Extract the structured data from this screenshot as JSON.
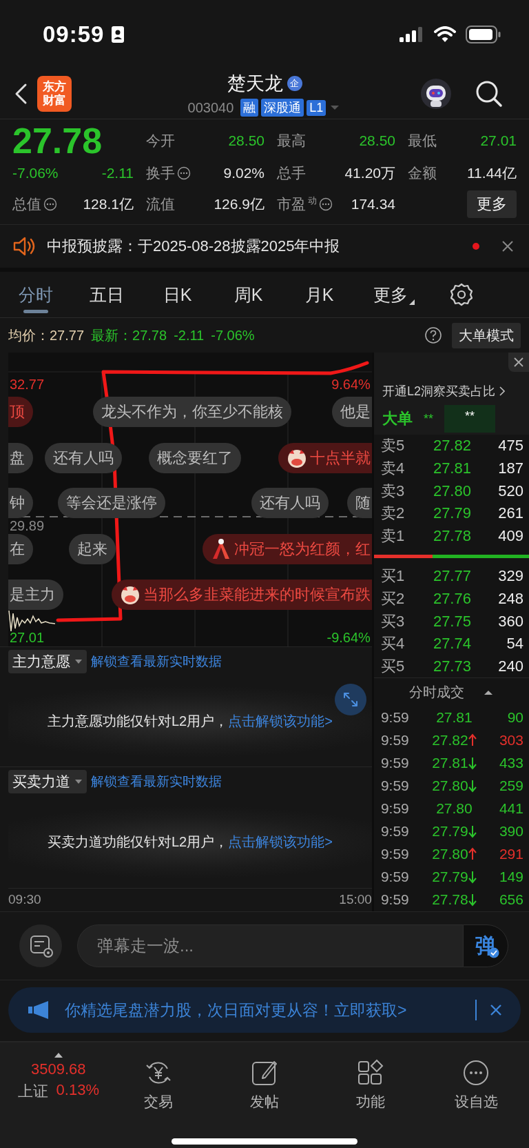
{
  "status_bar": {
    "time": "09:59"
  },
  "header": {
    "logo": "东方财富",
    "title": "楚天龙",
    "title_badge": "企",
    "code": "003040",
    "tags": [
      "融",
      "深股通",
      "L1"
    ]
  },
  "quote": {
    "price": "27.78",
    "color": "#2bc42b",
    "change_pct": "-7.06%",
    "change": "-2.11",
    "stats": [
      {
        "label": "今开",
        "value": "28.50",
        "color": "#2bc42b",
        "info": false
      },
      {
        "label": "最高",
        "value": "28.50",
        "color": "#2bc42b",
        "info": false
      },
      {
        "label": "最低",
        "value": "27.01",
        "color": "#2bc42b",
        "info": false
      },
      {
        "label": "换手",
        "value": "9.02%",
        "color": "#e6e6e6",
        "info": true
      },
      {
        "label": "总手",
        "value": "41.20万",
        "color": "#e6e6e6",
        "info": false
      },
      {
        "label": "金额",
        "value": "11.44亿",
        "color": "#e6e6e6",
        "info": false
      },
      {
        "label": "总值",
        "value": "128.1亿",
        "color": "#e6e6e6",
        "info": true
      },
      {
        "label": "流值",
        "value": "126.9亿",
        "color": "#e6e6e6",
        "info": false
      },
      {
        "label": "市盈",
        "sup": "动",
        "value": "174.34",
        "color": "#e6e6e6",
        "info": true
      }
    ],
    "more_button": "更多"
  },
  "notice": {
    "text": "中报预披露：于2025-08-28披露2025年中报"
  },
  "tabs": [
    {
      "label": "分时",
      "selected": true,
      "kind": "tab"
    },
    {
      "label": "五日",
      "selected": false,
      "kind": "tab"
    },
    {
      "label": "日K",
      "selected": false,
      "kind": "tab"
    },
    {
      "label": "周K",
      "selected": false,
      "kind": "tab"
    },
    {
      "label": "月K",
      "selected": false,
      "kind": "tab"
    },
    {
      "label": "更多",
      "selected": false,
      "kind": "menu"
    }
  ],
  "info_line": {
    "avg_label": "均价：",
    "avg_value": "27.77",
    "latest_label": "最新：",
    "latest_value": "27.78",
    "latest_change": "-2.11",
    "latest_pct": "-7.06%",
    "mode_button": "大单模式"
  },
  "chart": {
    "price_high": "32.77",
    "pct_high": "9.64%",
    "price_prev": "29.89",
    "price_low": "27.01",
    "pct_low": "-9.64%",
    "danmaku": [
      [
        {
          "text": "顶",
          "kind": "red"
        },
        {
          "text": "龙头不作为，你至少不能核",
          "kind": "plain"
        },
        {
          "text": "他是",
          "kind": "plain"
        }
      ],
      [
        {
          "text": "盘",
          "kind": "plain"
        },
        {
          "text": "还有人吗",
          "kind": "plain"
        },
        {
          "text": "概念要红了",
          "kind": "plain"
        },
        {
          "text": "十点半就",
          "kind": "red_mascot"
        }
      ],
      [
        {
          "text": "钟",
          "kind": "plain"
        },
        {
          "text": "等会还是涨停",
          "kind": "plain"
        },
        {
          "text": "还有人吗",
          "kind": "plain"
        },
        {
          "text": "随",
          "kind": "plain"
        }
      ],
      [
        {
          "text": "在",
          "kind": "plain"
        },
        {
          "text": "起来",
          "kind": "plain"
        },
        {
          "text": "冲冠一怒为红颜，红",
          "kind": "red_cracker"
        }
      ],
      [
        {
          "text": "是主力",
          "kind": "plain"
        },
        {
          "text": "当那么多韭菜能进来的时候宣布跌",
          "kind": "red_mascot"
        }
      ]
    ]
  },
  "panels": [
    {
      "title": "主力意愿",
      "link": "解锁查看最新实时数据",
      "message": "主力意愿功能仅针对L2用户，",
      "action": "点击解锁该功能>",
      "expand_button": true
    },
    {
      "title": "买卖力道",
      "link": "解锁查看最新实时数据",
      "message": "买卖力道功能仅针对L2用户，",
      "action": "点击解锁该功能>",
      "expand_button": false
    }
  ],
  "time_axis": {
    "start": "09:30",
    "end": "15:00"
  },
  "order_book": {
    "promo": "开通L2洞察买卖占比",
    "big_order_label": "大单",
    "big_order_values": [
      "**",
      "**"
    ],
    "asks": [
      {
        "label": "卖5",
        "price": "27.82",
        "volume": "475"
      },
      {
        "label": "卖4",
        "price": "27.81",
        "volume": "187"
      },
      {
        "label": "卖3",
        "price": "27.80",
        "volume": "520"
      },
      {
        "label": "卖2",
        "price": "27.79",
        "volume": "261"
      },
      {
        "label": "卖1",
        "price": "27.78",
        "volume": "409"
      }
    ],
    "split": {
      "level": 0.38
    },
    "bids": [
      {
        "label": "买1",
        "price": "27.77",
        "volume": "329"
      },
      {
        "label": "买2",
        "price": "27.76",
        "volume": "248"
      },
      {
        "label": "买3",
        "price": "27.75",
        "volume": "360"
      },
      {
        "label": "买4",
        "price": "27.74",
        "volume": "54"
      },
      {
        "label": "买5",
        "price": "27.73",
        "volume": "240"
      }
    ],
    "trades_title": "分时成交",
    "trades": [
      {
        "time": "9:59",
        "price": "27.81",
        "volume": "90",
        "kind": "plain"
      },
      {
        "time": "9:59",
        "price": "27.82",
        "volume": "303",
        "kind": "up"
      },
      {
        "time": "9:59",
        "price": "27.81",
        "volume": "433",
        "kind": "down"
      },
      {
        "time": "9:59",
        "price": "27.80",
        "volume": "259",
        "kind": "down"
      },
      {
        "time": "9:59",
        "price": "27.80",
        "volume": "441",
        "kind": "plain"
      },
      {
        "time": "9:59",
        "price": "27.79",
        "volume": "390",
        "kind": "down"
      },
      {
        "time": "9:59",
        "price": "27.80",
        "volume": "291",
        "kind": "up"
      },
      {
        "time": "9:59",
        "price": "27.79",
        "volume": "149",
        "kind": "down"
      },
      {
        "time": "9:59",
        "price": "27.78",
        "volume": "656",
        "kind": "down"
      }
    ]
  },
  "comment_bar": {
    "placeholder": "弹幕走一波...",
    "send_button": "弹"
  },
  "promo_banner": {
    "text": "你精选尾盘潜力股，次日面对更从容！立即获取>"
  },
  "bottom_nav": {
    "index": {
      "value": "3509.68",
      "name": "上证",
      "pct": "0.13%"
    },
    "items": [
      {
        "label": "交易",
        "kind": "trade"
      },
      {
        "label": "发帖",
        "kind": "post"
      },
      {
        "label": "功能",
        "kind": "apps"
      },
      {
        "label": "设自选",
        "kind": "more"
      }
    ]
  }
}
